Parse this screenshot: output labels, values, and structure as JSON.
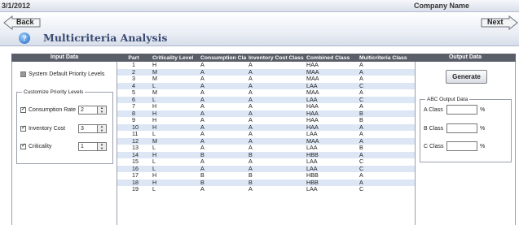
{
  "header": {
    "date": "3/1/2012",
    "company": "Company Name"
  },
  "nav": {
    "back_label": "Back",
    "next_label": "Next"
  },
  "title": {
    "text": "Multicriteria Analysis",
    "help_glyph": "?"
  },
  "input_panel": {
    "heading": "Input Data",
    "system_default_label": "System Default Priority Levels",
    "system_default_checked": false,
    "customize_legend": "Customize Priority Levels",
    "criteria": [
      {
        "label": "Consumption Rate",
        "checked": true,
        "value": "2"
      },
      {
        "label": "Inventory Cost",
        "checked": true,
        "value": "3"
      },
      {
        "label": "Criticality",
        "checked": true,
        "value": "1"
      }
    ]
  },
  "table": {
    "headers": [
      "Part",
      "Criticality Level",
      "Consumption Class",
      "Inventory Cost Class",
      "Combined Class",
      "Multicriteria Class"
    ],
    "rows": [
      [
        "1",
        "H",
        "A",
        "A",
        "HAA",
        "A"
      ],
      [
        "2",
        "M",
        "A",
        "A",
        "MAA",
        "A"
      ],
      [
        "3",
        "M",
        "A",
        "A",
        "MAA",
        "A"
      ],
      [
        "4",
        "L",
        "A",
        "A",
        "LAA",
        "C"
      ],
      [
        "5",
        "M",
        "A",
        "A",
        "MAA",
        "A"
      ],
      [
        "6",
        "L",
        "A",
        "A",
        "LAA",
        "C"
      ],
      [
        "7",
        "H",
        "A",
        "A",
        "HAA",
        "A"
      ],
      [
        "8",
        "H",
        "A",
        "A",
        "HAA",
        "B"
      ],
      [
        "9",
        "H",
        "A",
        "A",
        "HAA",
        "B"
      ],
      [
        "10",
        "H",
        "A",
        "A",
        "HAA",
        "A"
      ],
      [
        "11",
        "L",
        "A",
        "A",
        "LAA",
        "A"
      ],
      [
        "12",
        "M",
        "A",
        "A",
        "MAA",
        "A"
      ],
      [
        "13",
        "L",
        "A",
        "A",
        "LAA",
        "B"
      ],
      [
        "14",
        "H",
        "B",
        "B",
        "HBB",
        "A"
      ],
      [
        "15",
        "L",
        "A",
        "A",
        "LAA",
        "C"
      ],
      [
        "16",
        "L",
        "A",
        "A",
        "LAA",
        "C"
      ],
      [
        "17",
        "H",
        "B",
        "B",
        "HBB",
        "A"
      ],
      [
        "18",
        "H",
        "B",
        "B",
        "HBB",
        "A"
      ],
      [
        "19",
        "L",
        "A",
        "A",
        "LAA",
        "C"
      ]
    ]
  },
  "output_panel": {
    "heading": "Output Data",
    "generate_label": "Generate",
    "legend": "ABC Output Data",
    "classes": [
      {
        "label": "A Class",
        "value": "",
        "unit": "%"
      },
      {
        "label": "B Class",
        "value": "",
        "unit": "%"
      },
      {
        "label": "C Class",
        "value": "",
        "unit": "%"
      }
    ]
  },
  "colors": {
    "header_dark": "#5a5e68",
    "row_alt": "#dce6f4",
    "title_text": "#3a4a72"
  }
}
